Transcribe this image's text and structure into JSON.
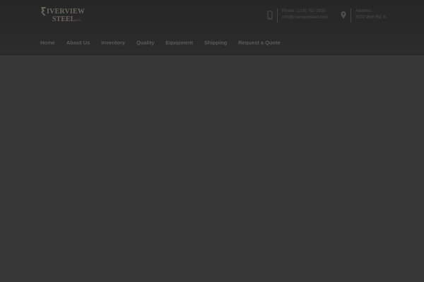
{
  "logo": {
    "line1": "IVERVIEW",
    "line2": "STEEL",
    "tagline": "INC.",
    "mark_color": "#6b665c"
  },
  "contact": {
    "phone": {
      "icon": "mobile-phone-icon",
      "line1": "Phone: (219) 762-2650",
      "line2": "info@riverviewsteel.com"
    },
    "address": {
      "icon": "map-pin-icon",
      "line1": "Address:",
      "line2": "3030 Wolf Rd, IL"
    }
  },
  "nav": {
    "items": [
      {
        "label": "Home"
      },
      {
        "label": "About Us"
      },
      {
        "label": "Inventory"
      },
      {
        "label": "Quality"
      },
      {
        "label": "Equipment"
      },
      {
        "label": "Shipping"
      },
      {
        "label": "Request a Quote"
      }
    ]
  },
  "colors": {
    "header_bg": "#2a2a2a",
    "page_bg": "#373737",
    "nav_text": "#5a5a5a"
  }
}
